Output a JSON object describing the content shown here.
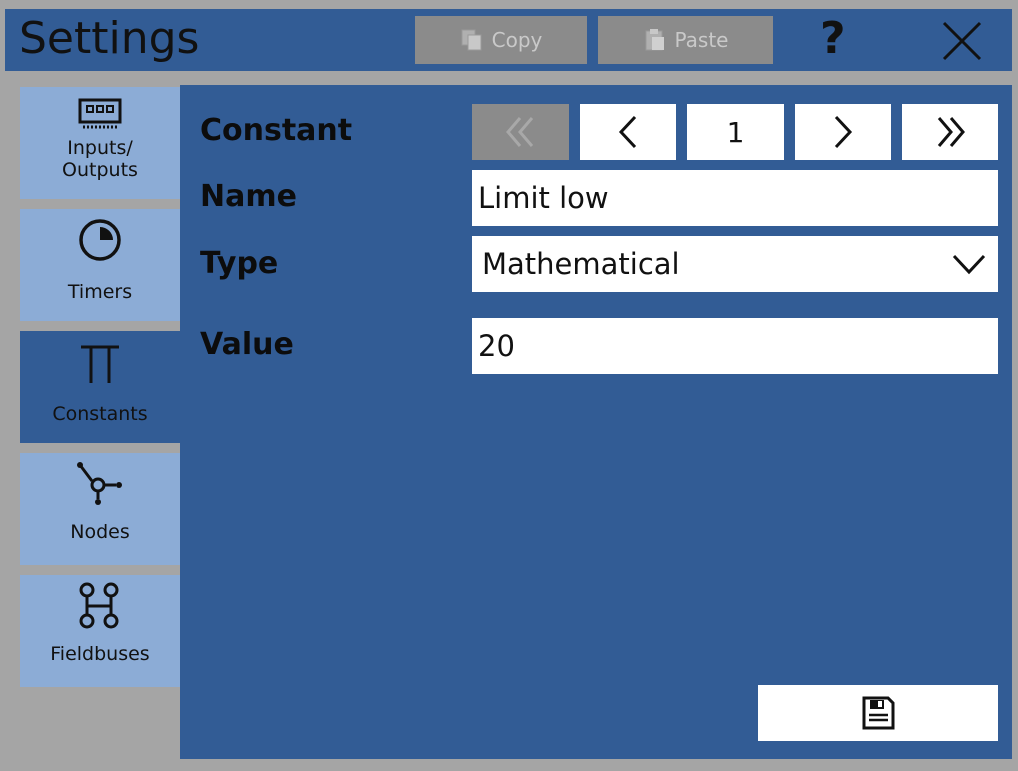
{
  "window": {
    "title": "Settings"
  },
  "toolbar": {
    "copy_label": "Copy",
    "paste_label": "Paste",
    "help_label": "?",
    "close_icon": "close-icon"
  },
  "sidebar": {
    "items": [
      {
        "label1": "Inputs/",
        "label2": "Outputs",
        "icon": "io-module-icon",
        "active": false
      },
      {
        "label": "Timers",
        "icon": "timer-icon",
        "active": false
      },
      {
        "label": "Constants",
        "icon": "pi-icon",
        "active": true
      },
      {
        "label": "Nodes",
        "icon": "node-icon",
        "active": false
      },
      {
        "label": "Fieldbuses",
        "icon": "fieldbus-icon",
        "active": false
      }
    ]
  },
  "form": {
    "constant_label": "Constant",
    "constant_index": "1",
    "name_label": "Name",
    "name_value": "Limit low",
    "type_label": "Type",
    "type_value": "Mathematical",
    "value_label": "Value",
    "value_value": "20"
  },
  "colors": {
    "panel": "#325c95",
    "sidebar_inactive": "#8cacd6",
    "disabled": "#8b8b8b",
    "background": "#a5a5a5"
  }
}
